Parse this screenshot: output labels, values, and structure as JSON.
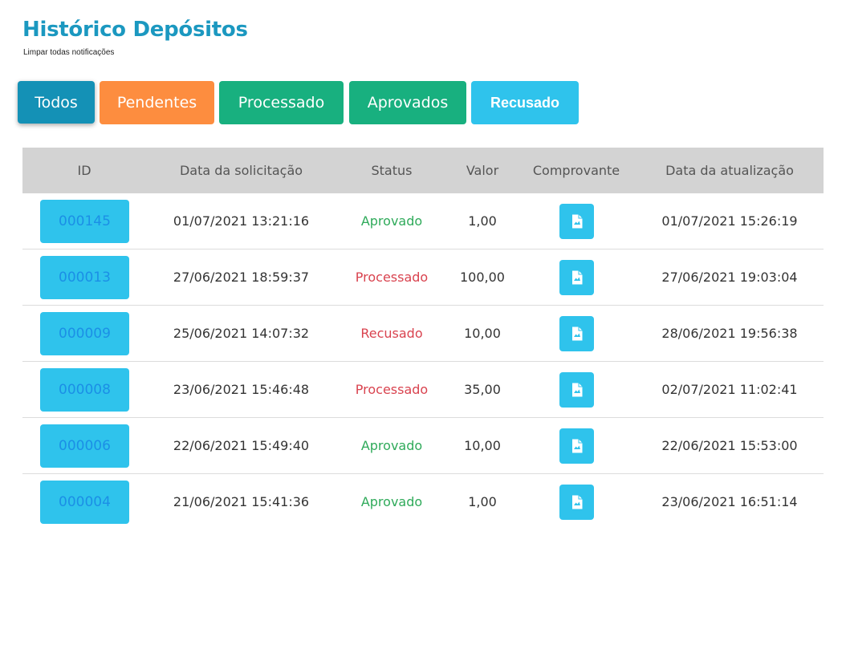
{
  "header": {
    "title": "Histórico Depósitos",
    "clear_link": "Limpar todas notificações"
  },
  "filters": [
    {
      "label": "Todos",
      "color": "#1491b6"
    },
    {
      "label": "Pendentes",
      "color": "#fd8d3f"
    },
    {
      "label": "Processado",
      "color": "#18b07f"
    },
    {
      "label": "Aprovados",
      "color": "#18b07f"
    },
    {
      "label": "Recusado",
      "color": "#2fc3ec"
    }
  ],
  "table": {
    "columns": [
      "ID",
      "Data da solicitação",
      "Status",
      "Valor",
      "Comprovante",
      "Data da atualização"
    ],
    "rows": [
      {
        "id": "000145",
        "requested": "01/07/2021 13:21:16",
        "status": "Aprovado",
        "value": "1,00",
        "receipt_icon": "document-icon",
        "updated": "01/07/2021 15:26:19"
      },
      {
        "id": "000013",
        "requested": "27/06/2021 18:59:37",
        "status": "Processado",
        "value": "100,00",
        "receipt_icon": "document-icon",
        "updated": "27/06/2021 19:03:04"
      },
      {
        "id": "000009",
        "requested": "25/06/2021 14:07:32",
        "status": "Recusado",
        "value": "10,00",
        "receipt_icon": "document-icon",
        "updated": "28/06/2021 19:56:38"
      },
      {
        "id": "000008",
        "requested": "23/06/2021 15:46:48",
        "status": "Processado",
        "value": "35,00",
        "receipt_icon": "document-icon",
        "updated": "02/07/2021 11:02:41"
      },
      {
        "id": "000006",
        "requested": "22/06/2021 15:49:40",
        "status": "Aprovado",
        "value": "10,00",
        "receipt_icon": "document-icon",
        "updated": "22/06/2021 15:53:00"
      },
      {
        "id": "000004",
        "requested": "21/06/2021 15:41:36",
        "status": "Aprovado",
        "value": "1,00",
        "receipt_icon": "document-icon",
        "updated": "23/06/2021 16:51:14"
      }
    ]
  },
  "colors": {
    "title": "#1b98c0",
    "approved": "#2faa5a",
    "processed": "#d9434f",
    "refused": "#d9434f",
    "id_button": "#2fc3ec",
    "id_text": "#1b8fe6"
  }
}
